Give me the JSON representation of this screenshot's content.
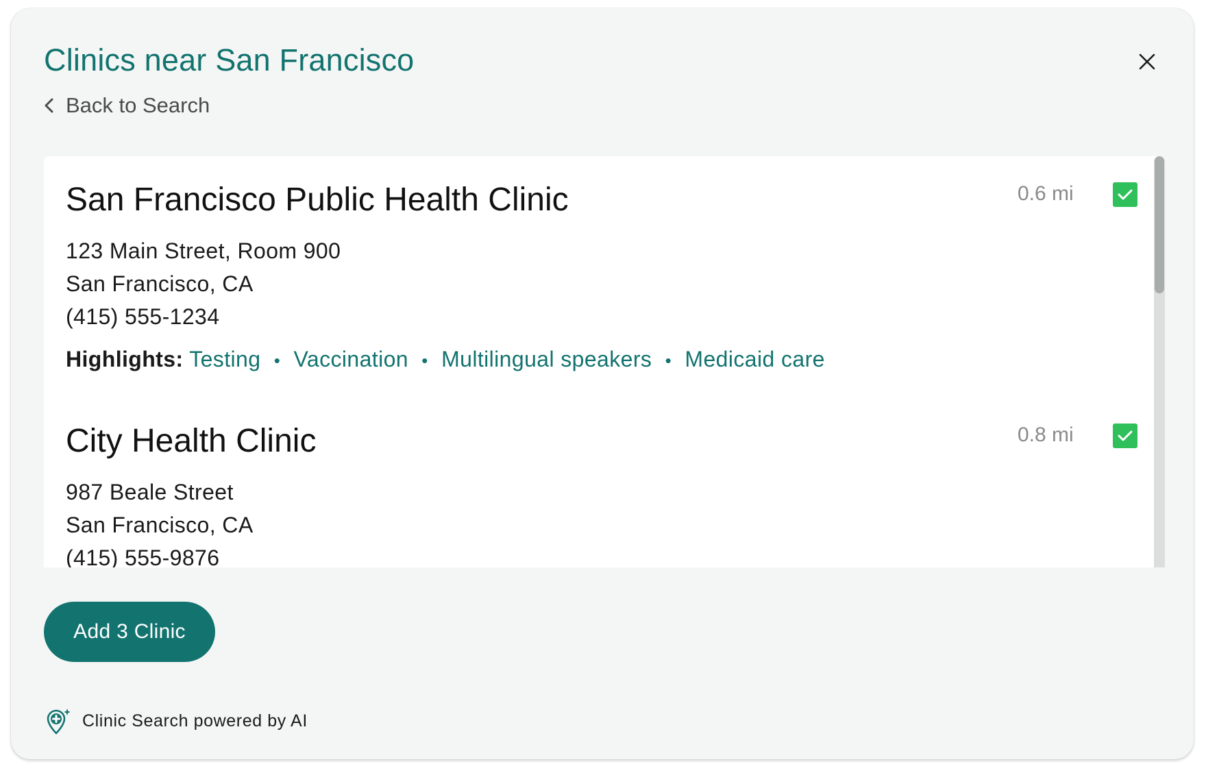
{
  "header": {
    "title": "Clinics near San Francisco",
    "back_label": "Back to Search"
  },
  "clinics": [
    {
      "name": "San Francisco Public Health Clinic",
      "distance": "0.6 mi",
      "address_line1": "123 Main Street, Room 900",
      "address_line2": "San Francisco, CA",
      "phone": "(415) 555-1234",
      "selected": true,
      "highlights_label": "Highlights:",
      "highlights": [
        "Testing",
        "Vaccination",
        "Multilingual speakers",
        "Medicaid care"
      ],
      "separator": "•"
    },
    {
      "name": "City Health Clinic",
      "distance": "0.8 mi",
      "address_line1": "987 Beale Street",
      "address_line2": "San Francisco, CA",
      "phone": "(415) 555-9876",
      "selected": true
    }
  ],
  "actions": {
    "add_label": "Add 3 Clinic"
  },
  "footer": {
    "text": "Clinic Search powered by AI",
    "icon": "clinic-ai-pin-icon"
  },
  "colors": {
    "accent": "#12736f",
    "check": "#2fbf5b",
    "panel_bg": "#f4f6f5"
  }
}
